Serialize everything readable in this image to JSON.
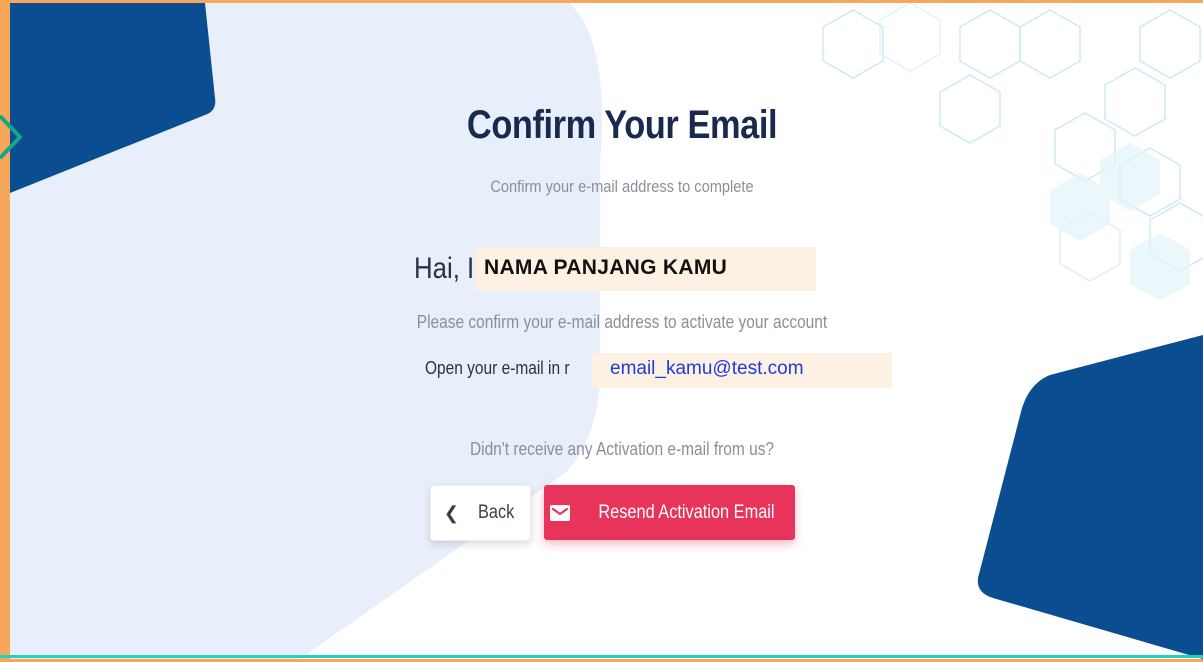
{
  "page": {
    "title": "Confirm Your Email",
    "subtitle": "Confirm your e-mail address to complete",
    "greeting_prefix": "Hai, I",
    "name_overlay": "NAMA PANJANG KAMU",
    "confirm_text": "Please confirm your e-mail address to activate your account",
    "open_prefix": "Open your e-mail in r",
    "email_overlay": "email_kamu@test.com",
    "not_received": "Didn't receive any Activation e-mail from us?"
  },
  "actions": {
    "back_label": "Back",
    "back_icon": "chevron-left-icon",
    "resend_label": "Resend Activation Email",
    "resend_icon": "mail-icon"
  },
  "colors": {
    "frame": "#f6a75a",
    "navy": "#0a4d91",
    "light_panel": "#e9eefb",
    "primary_button": "#e8345a",
    "title_text": "#1a2a4f",
    "highlight": "#fdf1e4",
    "email_text": "#1f3bd8",
    "hexagon_stroke": "#cdeaf5",
    "accent_line": "#1fd3c2"
  }
}
